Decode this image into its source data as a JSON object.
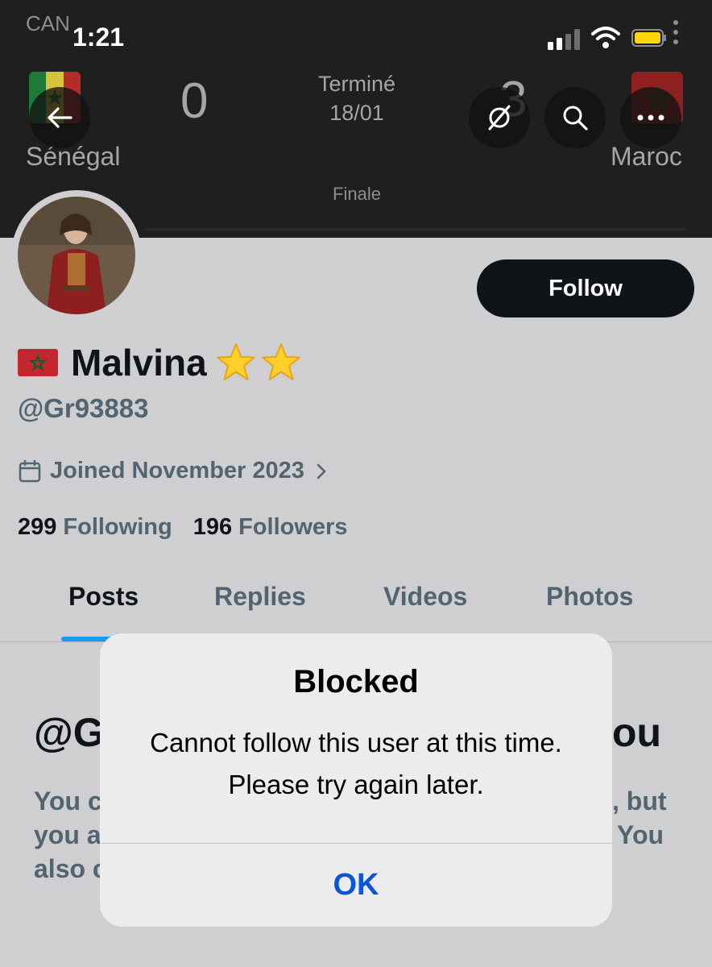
{
  "status_bar": {
    "carrier": "CAN",
    "time": "1:21"
  },
  "match": {
    "home_team": "Sénégal",
    "away_team": "Maroc",
    "home_score": "0",
    "away_score": "3",
    "status": "Terminé",
    "date": "18/01",
    "round": "Finale"
  },
  "profile": {
    "follow_label": "Follow",
    "display_name": "Malvina",
    "handle": "@Gr93883",
    "joined": "Joined November 2023",
    "following_count": "299",
    "following_label": "Following",
    "followers_count": "196",
    "followers_label": "Followers"
  },
  "tabs": [
    {
      "label": "Posts",
      "active": true
    },
    {
      "label": "Replies",
      "active": false
    },
    {
      "label": "Videos",
      "active": false
    },
    {
      "label": "Photos",
      "active": false
    }
  ],
  "background_message": {
    "title_left": "@G",
    "title_right": "ou",
    "line1_left": "You c",
    "line1_right": ", but",
    "line2_left": "you a",
    "line2_right": "You",
    "line3_left": "also c"
  },
  "alert": {
    "title": "Blocked",
    "message": "Cannot follow this user at this time. Please try again later.",
    "ok_label": "OK"
  },
  "icons": {
    "back": "back-arrow-icon",
    "grok": "grok-icon",
    "search": "search-icon",
    "more": "more-icon",
    "calendar": "calendar-icon",
    "chevron": "chevron-right-icon"
  },
  "colors": {
    "accent_blue": "#1d9bf0",
    "alert_button": "#0a56d6",
    "follow_button": "#0f1419",
    "secondary_text": "#536471"
  }
}
